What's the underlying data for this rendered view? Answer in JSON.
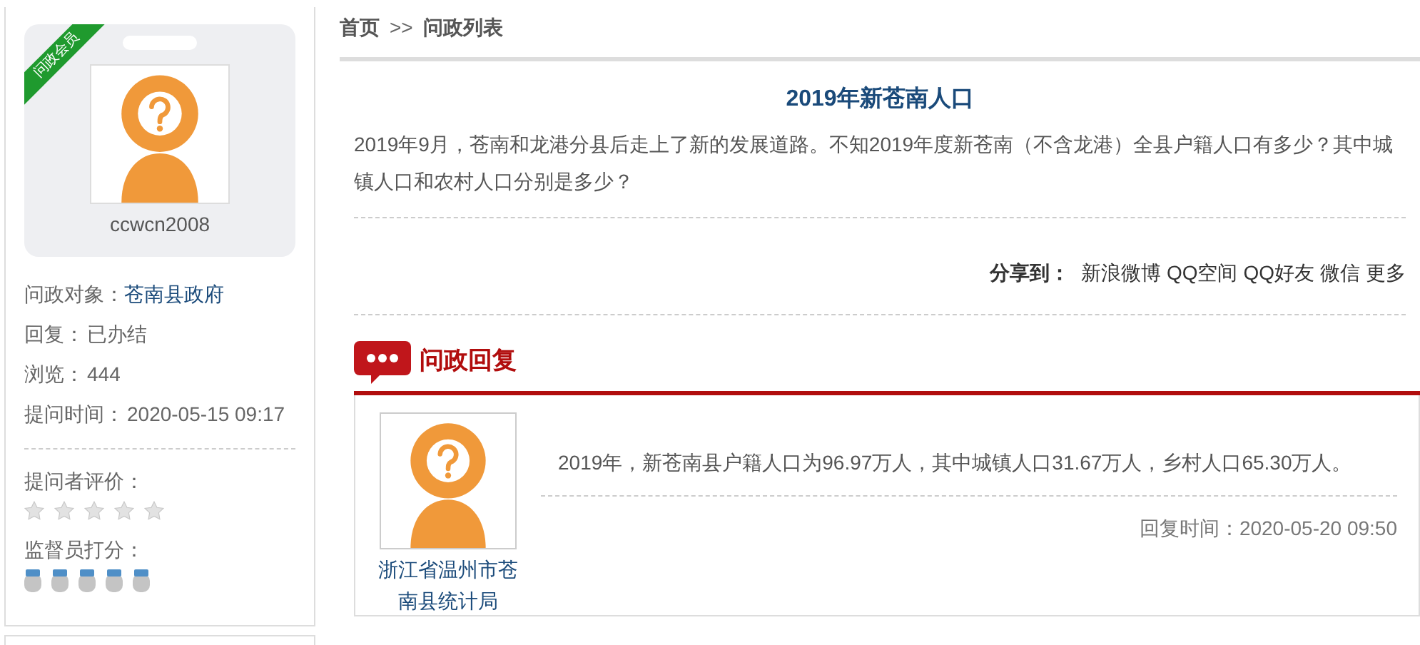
{
  "profile": {
    "badge": "问政会员",
    "name": "ccwcn2008"
  },
  "info": [
    {
      "label": "问政对象：",
      "value": "苍南县政府",
      "kind": "link"
    },
    {
      "label": "回复：",
      "value": "已办结",
      "kind": "text"
    },
    {
      "label": "浏览：",
      "value": "444",
      "kind": "text"
    },
    {
      "label": "提问时间：",
      "value": "2020-05-15 09:17",
      "kind": "text"
    }
  ],
  "ratings": [
    {
      "label": "提问者评价：",
      "kind": "star",
      "stars": 0
    },
    {
      "label": "监督员打分：",
      "kind": "medal",
      "stars": 0
    }
  ],
  "breadcrumb": [
    {
      "label": "首页",
      "kind": "link"
    },
    {
      "label": ">>",
      "kind": "separator"
    },
    {
      "label": "问政列表",
      "kind": "link"
    }
  ],
  "question": {
    "title": "2019年新苍南人口",
    "body": "2019年9月，苍南和龙港分县后走上了新的发展道路。不知2019年度新苍南（不含龙港）全县户籍人口有多少？其中城镇人口和农村人口分别是多少？"
  },
  "share": {
    "label": "分享到：",
    "links": [
      "新浪微博",
      "QQ空间",
      "QQ好友",
      "微信",
      "更多"
    ]
  },
  "reply": {
    "title": "问政回复",
    "author": "浙江省温州市苍南县统计局",
    "body": "2019年，新苍南县户籍人口为96.97万人，其中城镇人口31.67万人，乡村人口65.30万人。",
    "time": "回复时间：2020-05-20 09:50"
  }
}
